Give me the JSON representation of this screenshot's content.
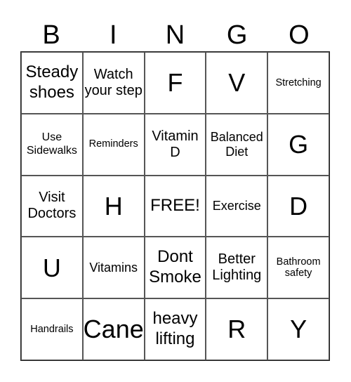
{
  "header": [
    "B",
    "I",
    "N",
    "G",
    "O"
  ],
  "cells": [
    [
      {
        "text": "Steady shoes",
        "size": "s-l"
      },
      {
        "text": "Watch your step",
        "size": "s-m"
      },
      {
        "text": "F",
        "size": "s-xl"
      },
      {
        "text": "V",
        "size": "s-xl"
      },
      {
        "text": "Stretching",
        "size": "s-xs"
      }
    ],
    [
      {
        "text": "Use Sidewalks",
        "size": "s-s"
      },
      {
        "text": "Reminders",
        "size": "s-xs"
      },
      {
        "text": "Vitamin D",
        "size": "s-m"
      },
      {
        "text": "Balanced Diet",
        "size": "s-ms"
      },
      {
        "text": "G",
        "size": "s-xl"
      }
    ],
    [
      {
        "text": "Visit Doctors",
        "size": "s-m"
      },
      {
        "text": "H",
        "size": "s-xl"
      },
      {
        "text": "FREE!",
        "size": "s-l"
      },
      {
        "text": "Exercise",
        "size": "s-ms"
      },
      {
        "text": "D",
        "size": "s-xl"
      }
    ],
    [
      {
        "text": "U",
        "size": "s-xl"
      },
      {
        "text": "Vitamins",
        "size": "s-ms"
      },
      {
        "text": "Dont Smoke",
        "size": "s-l"
      },
      {
        "text": "Better Lighting",
        "size": "s-m"
      },
      {
        "text": "Bathroom safety",
        "size": "s-xs"
      }
    ],
    [
      {
        "text": "Handrails",
        "size": "s-xs"
      },
      {
        "text": "Cane",
        "size": "s-xl"
      },
      {
        "text": "heavy lifting",
        "size": "s-l"
      },
      {
        "text": "R",
        "size": "s-xl"
      },
      {
        "text": "Y",
        "size": "s-xl"
      }
    ]
  ]
}
